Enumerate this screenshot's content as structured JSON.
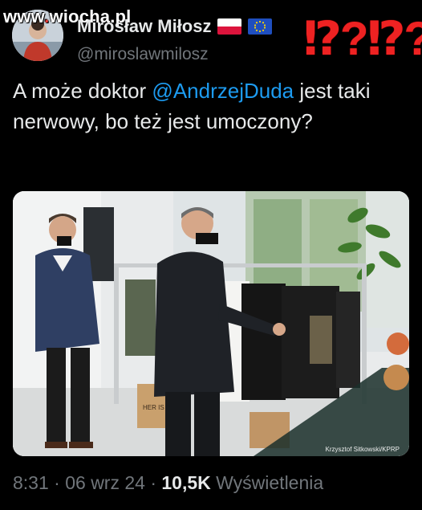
{
  "watermark": {
    "prefix": "www",
    "dot": ".",
    "suffix": "wiocha.pl"
  },
  "author": {
    "display_name": "Mirosław Miłosz",
    "handle": "@miroslawmilosz",
    "flag_1": "poland-flag-icon",
    "flag_2": "eu-flag-icon"
  },
  "overlay_reaction": "⁉?⁉?",
  "tweet": {
    "text_before": "A może doktor ",
    "mention": "@AndrzejDuda",
    "text_after": " jest taki nerwowy, bo też jest umoczony?"
  },
  "photo": {
    "credit": "Krzysztof Sitkowski/KPRP",
    "box_text": "HER IS BAD"
  },
  "meta": {
    "time": "8:31",
    "sep1": " · ",
    "date": "06 wrz 24",
    "sep2": " · ",
    "views": "10,5K",
    "views_label": " Wyświetlenia"
  },
  "colors": {
    "background": "#000000",
    "text": "#e7e9ea",
    "muted": "#71767b",
    "link": "#1d9bf0",
    "reaction": "#ee2222"
  }
}
